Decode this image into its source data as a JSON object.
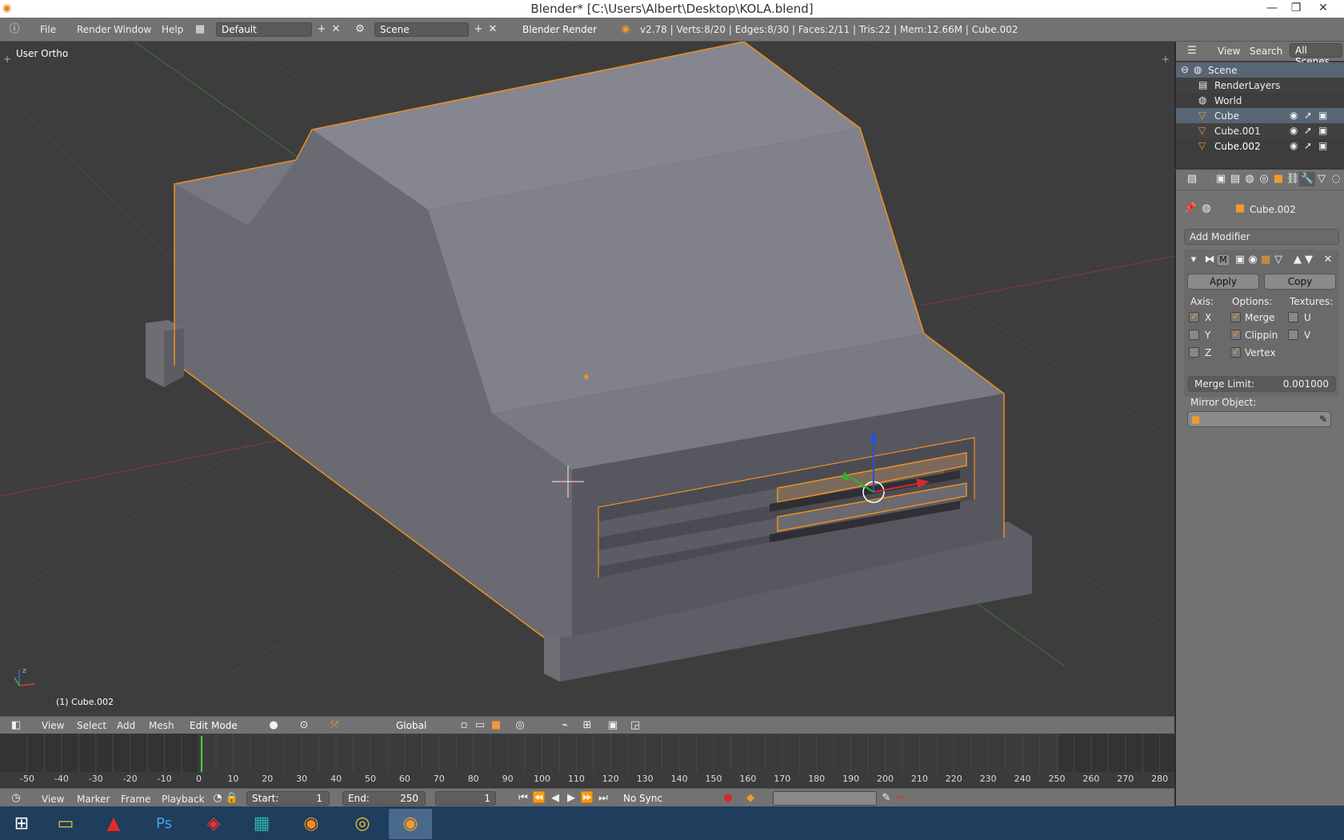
{
  "window": {
    "title": "Blender* [C:\\Users\\Albert\\Desktop\\KOLA.blend]",
    "minimize_glyph": "—",
    "restore_glyph": "❐",
    "close_glyph": "✕"
  },
  "info_header": {
    "menus": [
      "File",
      "Render",
      "Window",
      "Help"
    ],
    "screen_layout": "Default",
    "scene": "Scene",
    "render_engine": "Blender Render",
    "stats": "v2.78 | Verts:8/20 | Edges:8/30 | Faces:2/11 | Tris:22 | Mem:12.66M | Cube.002"
  },
  "viewport": {
    "view_name": "User Ortho",
    "object_label": "(1) Cube.002",
    "axis_labels": {
      "x": "x",
      "y": "y",
      "z": "z"
    }
  },
  "view3d_header": {
    "menus": [
      "View",
      "Select",
      "Add",
      "Mesh"
    ],
    "mode": "Edit Mode",
    "orientation": "Global"
  },
  "timeline": {
    "ruler_labels": [
      "-50",
      "-40",
      "-30",
      "-20",
      "-10",
      "0",
      "10",
      "20",
      "30",
      "40",
      "50",
      "60",
      "70",
      "80",
      "90",
      "100",
      "110",
      "120",
      "130",
      "140",
      "150",
      "160",
      "170",
      "180",
      "190",
      "200",
      "210",
      "220",
      "230",
      "240",
      "250",
      "260",
      "270",
      "280"
    ],
    "menus": [
      "View",
      "Marker",
      "Frame",
      "Playback"
    ],
    "start_label": "Start:",
    "start_value": "1",
    "end_label": "End:",
    "end_value": "250",
    "current_frame": "1",
    "sync": "No Sync"
  },
  "outliner": {
    "menus": [
      "View",
      "Search"
    ],
    "filter": "All Scenes",
    "items": [
      {
        "label": "Scene"
      },
      {
        "label": "RenderLayers"
      },
      {
        "label": "World"
      },
      {
        "label": "Cube"
      },
      {
        "label": "Cube.001"
      },
      {
        "label": "Cube.002"
      }
    ]
  },
  "properties": {
    "object_name": "Cube.002",
    "add_modifier": "Add Modifier",
    "modifier_badge": "M",
    "apply": "Apply",
    "copy": "Copy",
    "axis_heading": "Axis:",
    "options_heading": "Options:",
    "textures_heading": "Textures:",
    "axis": [
      {
        "label": "X",
        "checked": true
      },
      {
        "label": "Y",
        "checked": false
      },
      {
        "label": "Z",
        "checked": false
      }
    ],
    "options": [
      {
        "label": "Merge",
        "checked": true
      },
      {
        "label": "Clippin",
        "checked": true
      },
      {
        "label": "Vertex",
        "checked": true
      }
    ],
    "textures": [
      {
        "label": "U",
        "checked": false
      },
      {
        "label": "V",
        "checked": false
      }
    ],
    "merge_limit_label": "Merge Limit:",
    "merge_limit_value": "0.001000",
    "mirror_object_label": "Mirror Object:"
  },
  "taskbar": {
    "apps": [
      "windows-start",
      "file-explorer",
      "autocad",
      "photoshop",
      "sketchup",
      "maya",
      "firefox",
      "chrome",
      "blender"
    ],
    "active": "blender"
  },
  "colors": {
    "accent_orange": "#f29a2e",
    "selection_edge": "#f0901c",
    "header_grey": "#727272",
    "viewport_bg": "#3d3d3d"
  }
}
